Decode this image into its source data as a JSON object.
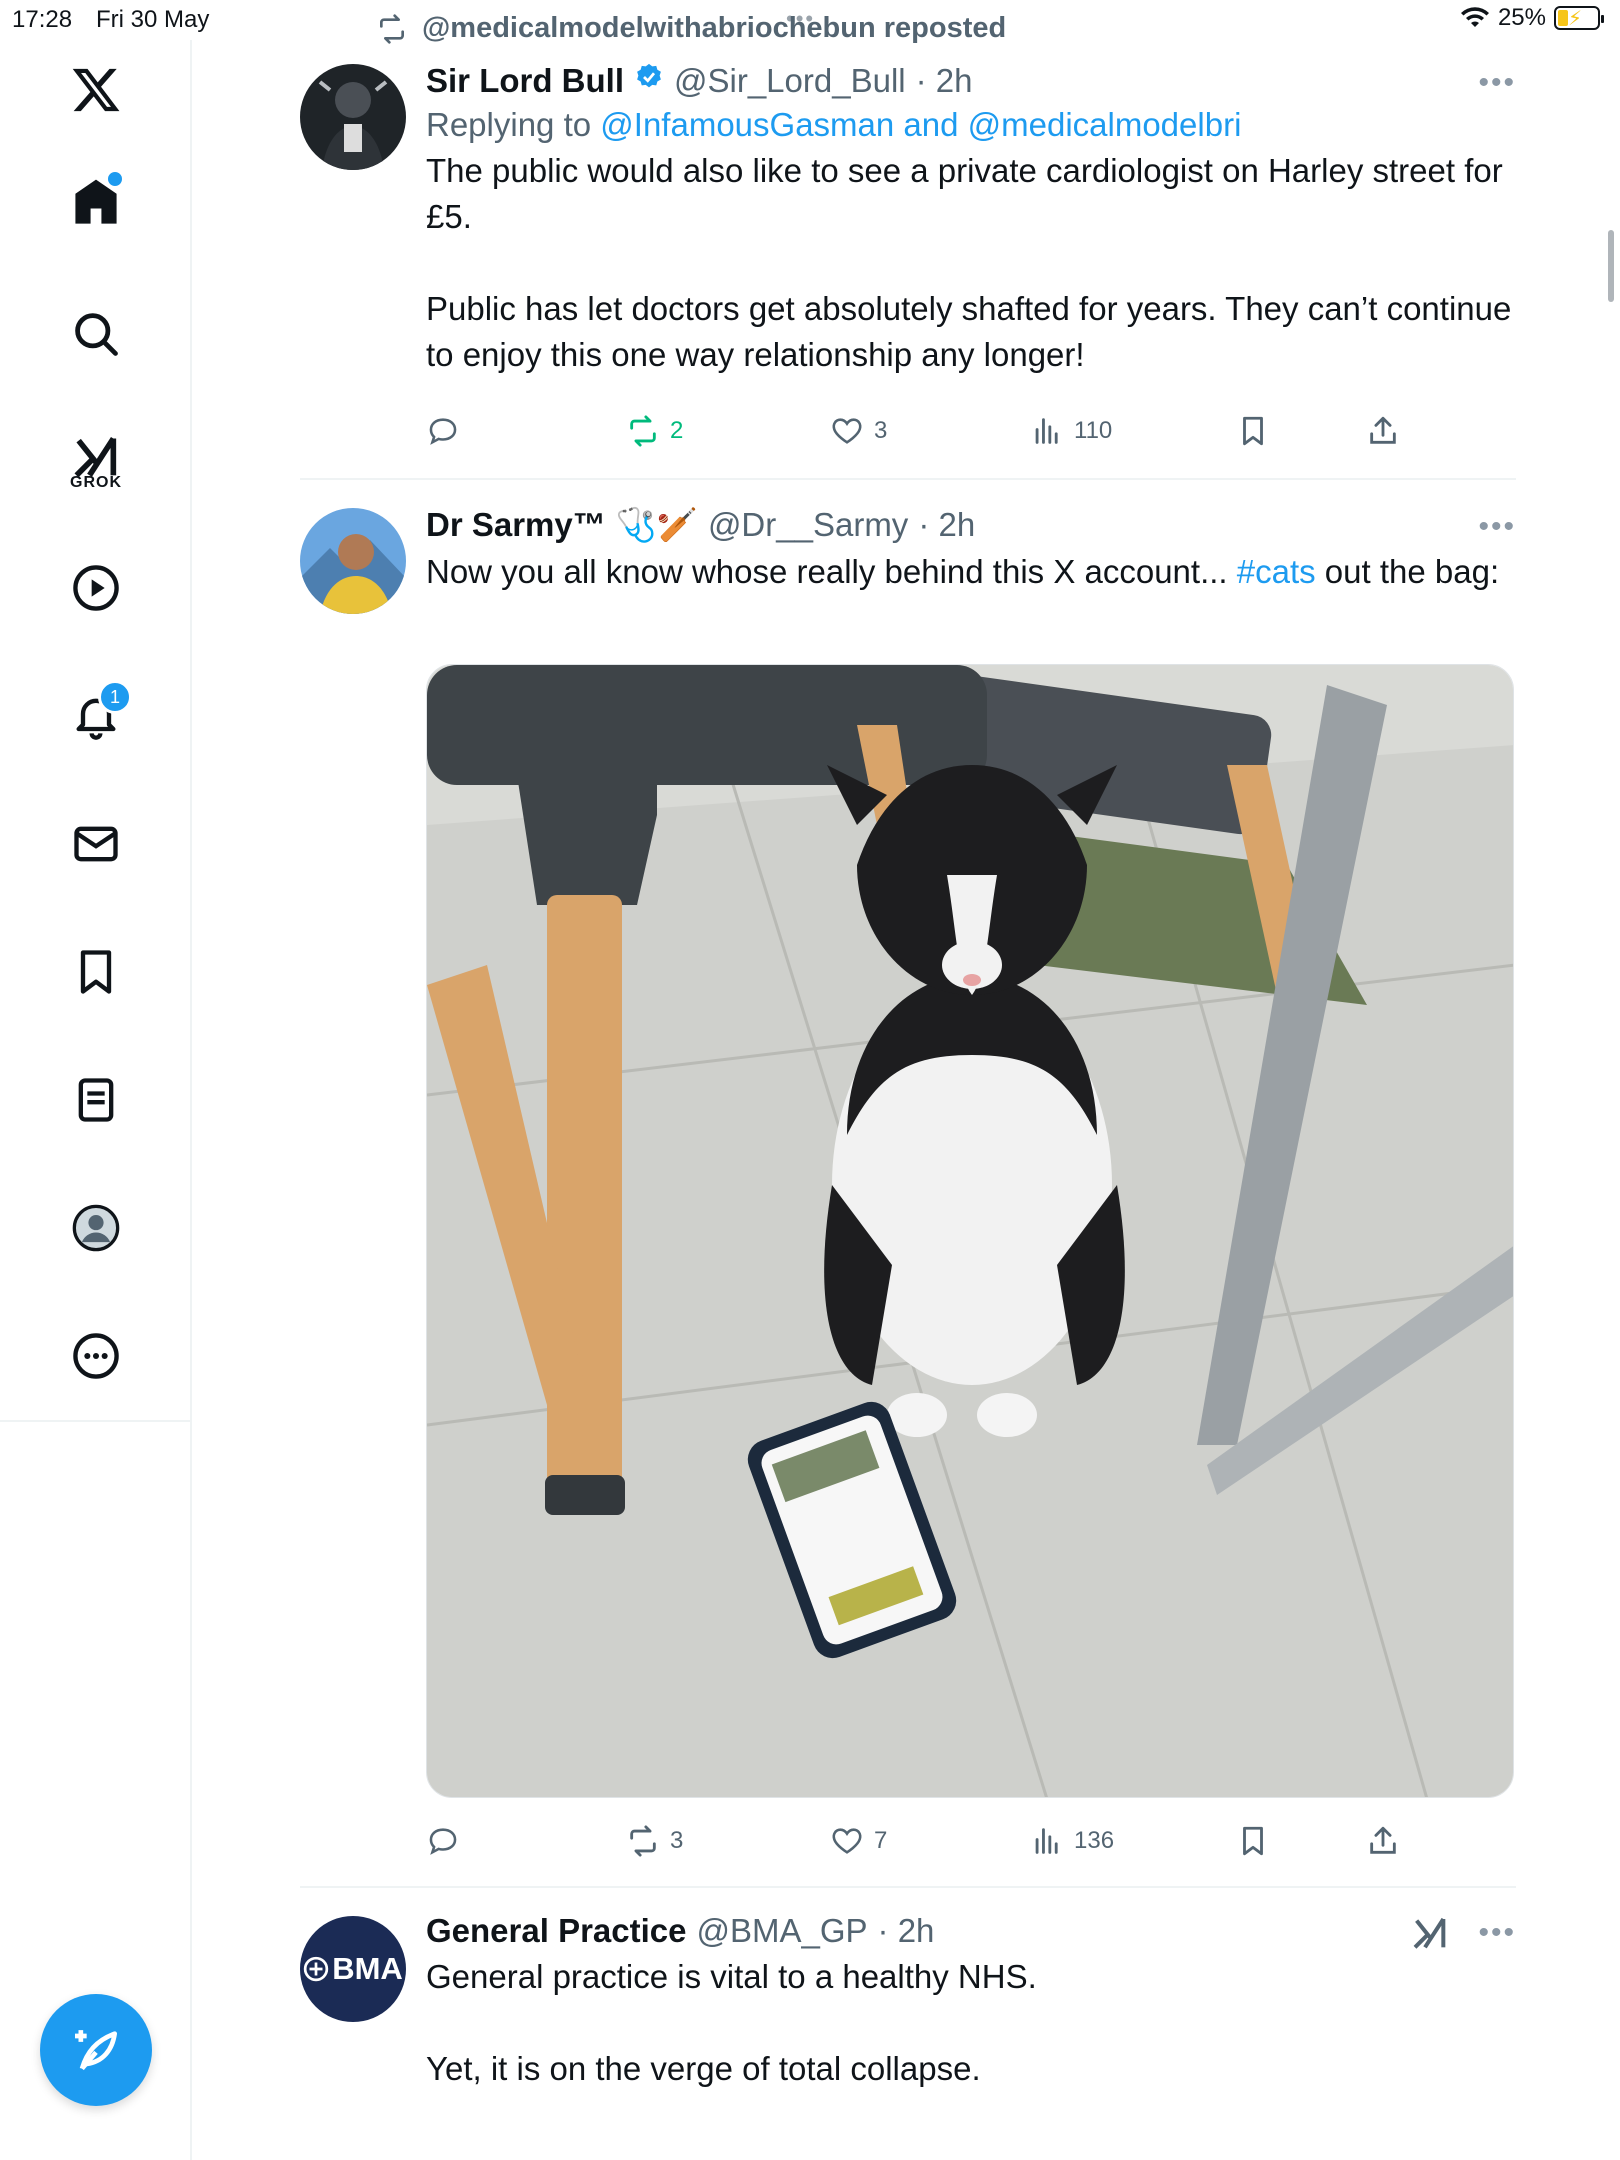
{
  "status_bar": {
    "time": "17:28",
    "date": "Fri 30 May",
    "battery": "25%"
  },
  "colors": {
    "accent": "#1d9bf0",
    "repost_green": "#00ba7c",
    "muted": "#536471"
  },
  "sidebar": {
    "grok_label": "GROK",
    "notifications_count": "1"
  },
  "repost_banner": "@medicalmodelwithabriochebun reposted",
  "tweets": [
    {
      "name": "Sir Lord Bull",
      "verified": true,
      "handle": "@Sir_Lord_Bull",
      "time": "· 2h",
      "reply_prefix": "Replying to",
      "reply_to": "@InfamousGasman and @medicalmodelbri",
      "text": "The public would also like to see a private cardiologist on Harley street for £5.\n\nPublic has let doctors get absolutely shafted for years. They can’t continue to enjoy this one way relationship any longer!",
      "stats": {
        "replies": "",
        "reposts": "2",
        "likes": "3",
        "views": "110"
      }
    },
    {
      "name": "Dr Sarmy™",
      "emoji": "🩺🏏",
      "handle": "@Dr__Sarmy",
      "time": "· 2h",
      "text_before": "Now you all know whose really behind this X account... ",
      "hashtag": "#cats",
      "text_after": " out the bag:",
      "stats": {
        "replies": "",
        "reposts": "3",
        "likes": "7",
        "views": "136"
      }
    },
    {
      "name": "General Practice",
      "handle": "@BMA_GP",
      "time": "· 2h",
      "avatar_text": "BMA",
      "text": "General practice is vital to a healthy NHS.\n\nYet, it is on the verge of total collapse."
    }
  ]
}
